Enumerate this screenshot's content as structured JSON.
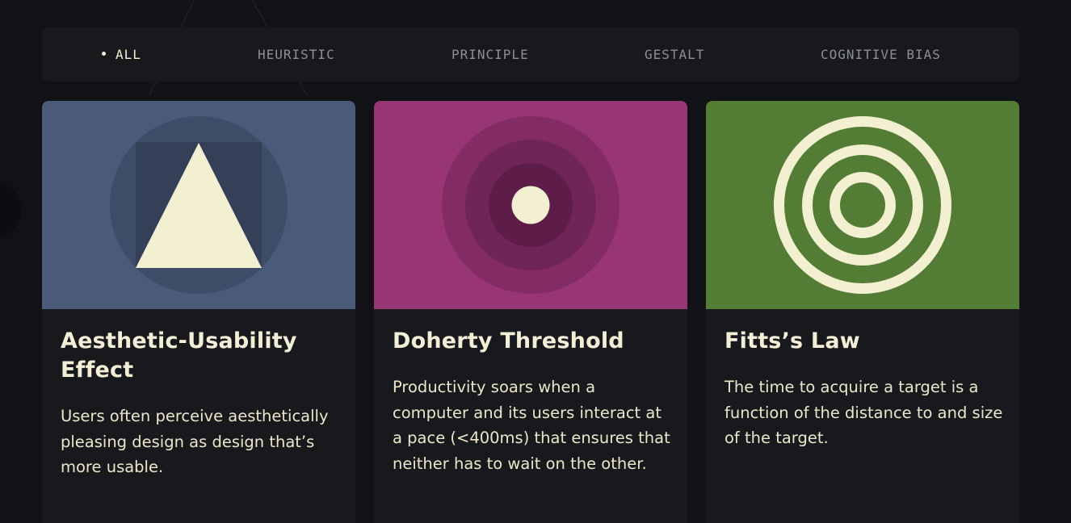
{
  "filters": [
    {
      "label": "ALL",
      "active": true
    },
    {
      "label": "HEURISTIC",
      "active": false
    },
    {
      "label": "PRINCIPLE",
      "active": false
    },
    {
      "label": "GESTALT",
      "active": false
    },
    {
      "label": "COGNITIVE BIAS",
      "active": false
    }
  ],
  "cards": [
    {
      "title": "Aesthetic-Usability Effect",
      "description": "Users often perceive aesthetically pleasing design as design that’s more usable.",
      "color": "#4a5b7a",
      "icon": "triangle-in-square-in-circle-icon"
    },
    {
      "title": "Doherty Threshold",
      "description": "Productivity soars when a computer and its users interact at a pace (<400ms) that ensures that neither has to wait on the other.",
      "color": "#983574",
      "icon": "concentric-circles-dot-icon"
    },
    {
      "title": "Fitts’s Law",
      "description": "The time to acquire a target is a function of the distance to and size of the target.",
      "color": "#537c35",
      "icon": "target-rings-icon"
    }
  ],
  "colors": {
    "background": "#111216",
    "surface": "#18191d",
    "text": "#f3efd6",
    "muted": "#8d8f96"
  }
}
